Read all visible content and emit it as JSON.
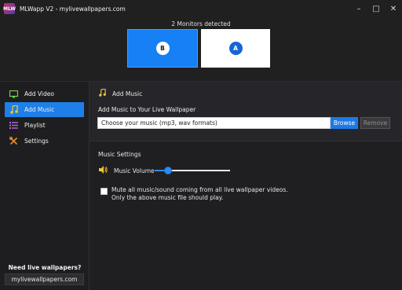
{
  "app": {
    "title": "MLWapp V2 - mylivewallpapers.com",
    "logo_text": "MLW",
    "controls": {
      "minimize": "–",
      "maximize": "□",
      "close": "✕"
    }
  },
  "monitors": {
    "label": "2 Monitors detected",
    "items": [
      {
        "id": "B",
        "selected": true
      },
      {
        "id": "A",
        "selected": false
      }
    ]
  },
  "sidebar": {
    "items": [
      {
        "label": "Add Video",
        "icon": "monitor-icon",
        "active": false
      },
      {
        "label": "Add Music",
        "icon": "music-note-icon",
        "active": true
      },
      {
        "label": "Playlist",
        "icon": "list-icon",
        "active": false
      },
      {
        "label": "Settings",
        "icon": "wrench-icon",
        "active": false
      }
    ],
    "footer": {
      "question": "Need live wallpapers?",
      "site": "mylivewallpapers.com"
    }
  },
  "main": {
    "section_title": "Add Music",
    "add_music": {
      "heading": "Add Music to Your Live Wallpaper",
      "placeholder": "Choose your music (mp3, wav formats)",
      "browse_label": "Browse",
      "remove_label": "Remove"
    },
    "settings": {
      "heading": "Music Settings",
      "volume_label": "Music Volume",
      "volume_percent": 18,
      "mute_checked": false,
      "mute_text_line1": "Mute all music/sound coming from all live wallpaper videos.",
      "mute_text_line2": "Only the above music file should play."
    }
  },
  "colors": {
    "accent": "#1f7fe8",
    "icon_green": "#7ad14a",
    "icon_purple": "#b466e0",
    "icon_orange": "#f08a2a",
    "icon_yellow": "#e8c830"
  }
}
